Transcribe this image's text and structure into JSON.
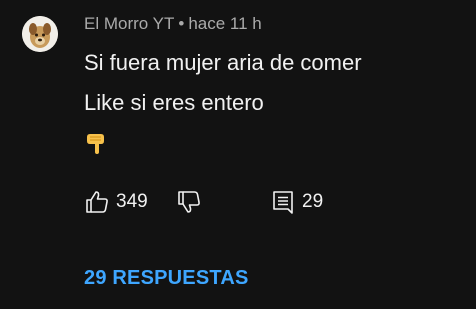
{
  "comment": {
    "author": "El Morro YT",
    "separator": "•",
    "time": "hace 11 h",
    "lines": [
      "Si fuera mujer aria de comer",
      "Like si eres entero"
    ],
    "emoji": "backhand-index-pointing-down-emoji"
  },
  "actions": {
    "likes": "349",
    "replies_count": "29"
  },
  "replies_link": "29 RESPUESTAS",
  "colors": {
    "background": "#121212",
    "meta_text": "#aaaaaa",
    "body_text": "#f1f1f1",
    "link": "#3ea6ff"
  }
}
